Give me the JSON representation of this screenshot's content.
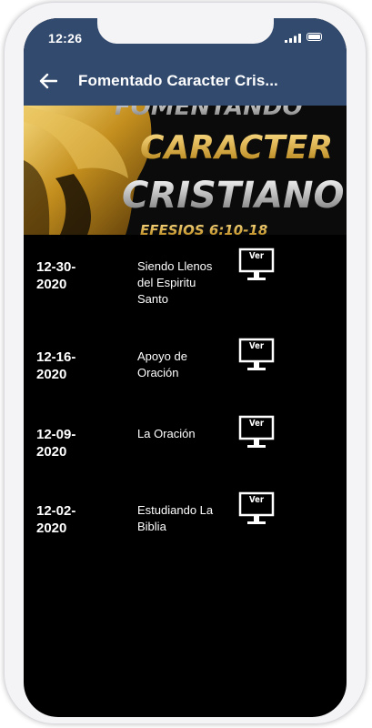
{
  "status": {
    "time": "12:26"
  },
  "header": {
    "title": "Fomentado Caracter Cris..."
  },
  "banner": {
    "line1": "FOMENTANDO",
    "line2": "CARACTER",
    "line3": "CRISTIANO",
    "line4": "EFESIOS 6:10-18"
  },
  "lessons": [
    {
      "date": "12-30-2020",
      "title": "Siendo Llenos del Espiritu Santo",
      "button": "Ver"
    },
    {
      "date": "12-16-2020",
      "title": "Apoyo de Oración",
      "button": "Ver"
    },
    {
      "date": "12-09-2020",
      "title": "La Oración",
      "button": "Ver"
    },
    {
      "date": "12-02-2020",
      "title": "Estudiando La Biblia",
      "button": "Ver"
    }
  ],
  "colors": {
    "appbar": "#324a6e",
    "background": "#000000",
    "text": "#ffffff",
    "gold": "#c9a431"
  },
  "icons": {
    "back": "arrow-left-icon",
    "view": "monitor-icon"
  }
}
